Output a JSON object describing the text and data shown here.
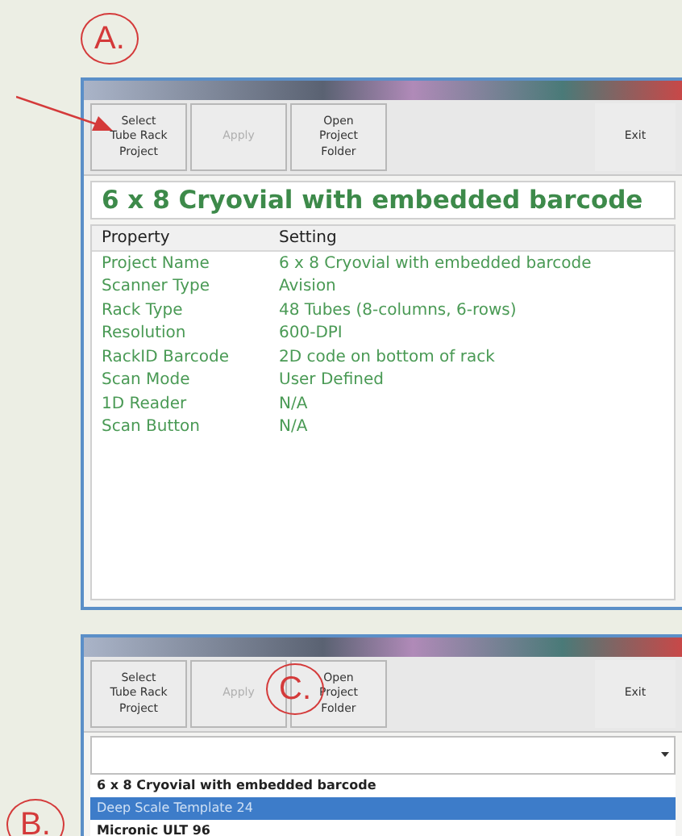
{
  "callouts": [
    {
      "label": "A."
    },
    {
      "label": "B."
    },
    {
      "label": "C."
    }
  ],
  "window_a": {
    "toolbar": [
      {
        "label": "Select\nTube Rack\nProject",
        "disabled": false
      },
      {
        "label": "Apply",
        "disabled": true
      },
      {
        "label": "Open\nProject\nFolder",
        "disabled": false
      },
      {
        "label": "Exit",
        "disabled": false
      }
    ],
    "project_title": "6 x 8 Cryovial with embedded barcode",
    "table": {
      "columns": [
        "Property",
        "Setting"
      ],
      "rows": [
        [
          "Project Name",
          "6 x 8 Cryovial with embedded barcode"
        ],
        [
          "Scanner Type",
          "Avision"
        ],
        [
          "Rack Type",
          "48 Tubes (8-columns, 6-rows)"
        ],
        [
          "Resolution",
          "600-DPI"
        ],
        [
          "RackID Barcode",
          "2D code on bottom of rack"
        ],
        [
          "Scan Mode",
          "User Defined"
        ],
        [
          "1D Reader",
          "N/A"
        ],
        [
          "Scan Button",
          "N/A"
        ]
      ]
    }
  },
  "window_b": {
    "toolbar": [
      {
        "label": "Select\nTube Rack\nProject",
        "disabled": false
      },
      {
        "label": "Apply",
        "disabled": true
      },
      {
        "label": "Open\nProject\nFolder",
        "disabled": false
      },
      {
        "label": "Exit",
        "disabled": false
      }
    ],
    "project_list": [
      {
        "label": "6 x 8 Cryovial with embedded barcode",
        "selected": false
      },
      {
        "label": "Deep Scale Template 24",
        "selected": true
      },
      {
        "label": "Micronic ULT 96",
        "selected": false
      }
    ]
  }
}
